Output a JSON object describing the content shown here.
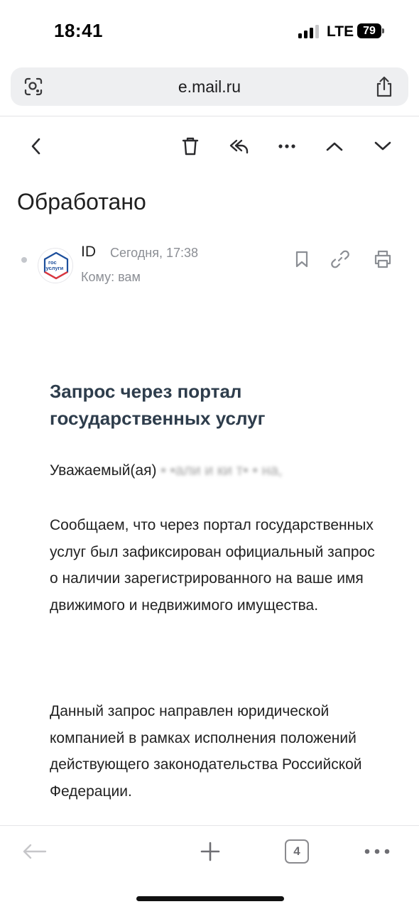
{
  "status_bar": {
    "time": "18:41",
    "network": "LTE",
    "battery": "79",
    "signal_bars_active": 3,
    "signal_bars_total": 4
  },
  "browser": {
    "url": "e.mail.ru",
    "tabs_count": "4",
    "icons": [
      "lens-icon",
      "share-icon",
      "back-arrow-icon",
      "plus-icon",
      "tabs-icon",
      "more-icon"
    ]
  },
  "mail_toolbar": {
    "icons": [
      "back-chevron-icon",
      "trash-icon",
      "reply-all-icon",
      "more-dots-icon",
      "chevron-up-icon",
      "chevron-down-icon"
    ]
  },
  "message": {
    "subject": "Обработано",
    "sender": "ID",
    "date": "Сегодня, 17:38",
    "recipient": "Кому: вам",
    "avatar_text_line1": "гос",
    "avatar_text_line2": "услуги",
    "row_icons": [
      "bookmark-icon",
      "link-icon",
      "print-icon"
    ]
  },
  "body": {
    "title": "Запрос через портал государственных услуг",
    "greeting_prefix": "Уважаемый(ая)",
    "greeting_blurred": "• •али и ки т• • на,",
    "paragraph_1": "Сообщаем, что через портал государственных услуг был зафиксирован официальный запрос о наличии зарегистрированного на ваше имя движимого и недвижимого имущества.",
    "paragraph_2": "Данный запрос направлен юридической компанией в рамках исполнения положений действующего законодательства Российской Федерации."
  },
  "colors": {
    "title_text": "#2e3d4c",
    "muted_text": "#8b8e94",
    "url_bar_bg": "#eeeff1",
    "gosuslugi_blue": "#1d4f9c",
    "gosuslugi_red": "#e0353b"
  }
}
